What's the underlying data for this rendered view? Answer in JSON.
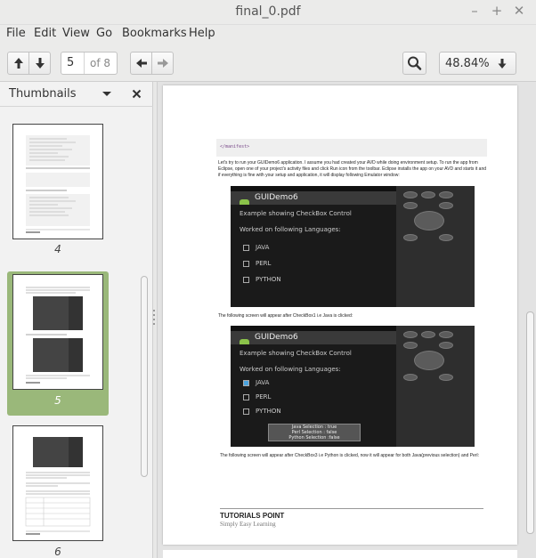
{
  "window": {
    "title": "final_0.pdf",
    "minimize": "–",
    "maximize": "+",
    "close": "✕"
  },
  "menu": [
    "File",
    "Edit",
    "View",
    "Go",
    "Bookmarks",
    "Help"
  ],
  "toolbar": {
    "current_page": "5",
    "of_pages": "of 8",
    "zoom": "48.84%"
  },
  "sidebar": {
    "title": "Thumbnails",
    "thumbnails": [
      {
        "label": "4",
        "selected": false
      },
      {
        "label": "5",
        "selected": true
      },
      {
        "label": "6",
        "selected": false
      }
    ]
  },
  "document": {
    "code_line": "</manifest>",
    "para1": "Let's try to run your GUIDemo6 application. I assume you had created your AVD while doing environment setup. To run the app from Eclipse, open one of your project's activity files and click Run icon from the toolbar. Eclipse installs the app on your AVD and starts it and if everything is fine with your setup and application, it will display following Emulator window:",
    "shot_title": "GUIDemo6",
    "shot_heading": "Example showing CheckBox Control",
    "shot_sub": "Worked on following Languages:",
    "options": [
      "JAVA",
      "PERL",
      "PYTHON"
    ],
    "para2": "The following screen will appear after CheckBox1 i.e Java is clicked:",
    "toast": [
      "Java Selection : true",
      "Perl Selection : false",
      "Python Selection :false"
    ],
    "para3": "The following screen will appear after CheckBox3 i.e Python is clicked, now it will appear for both Java(previous selection) and Perl:",
    "footer_title": "TUTORIALS POINT",
    "footer_sub": "Simply Easy Learning"
  }
}
